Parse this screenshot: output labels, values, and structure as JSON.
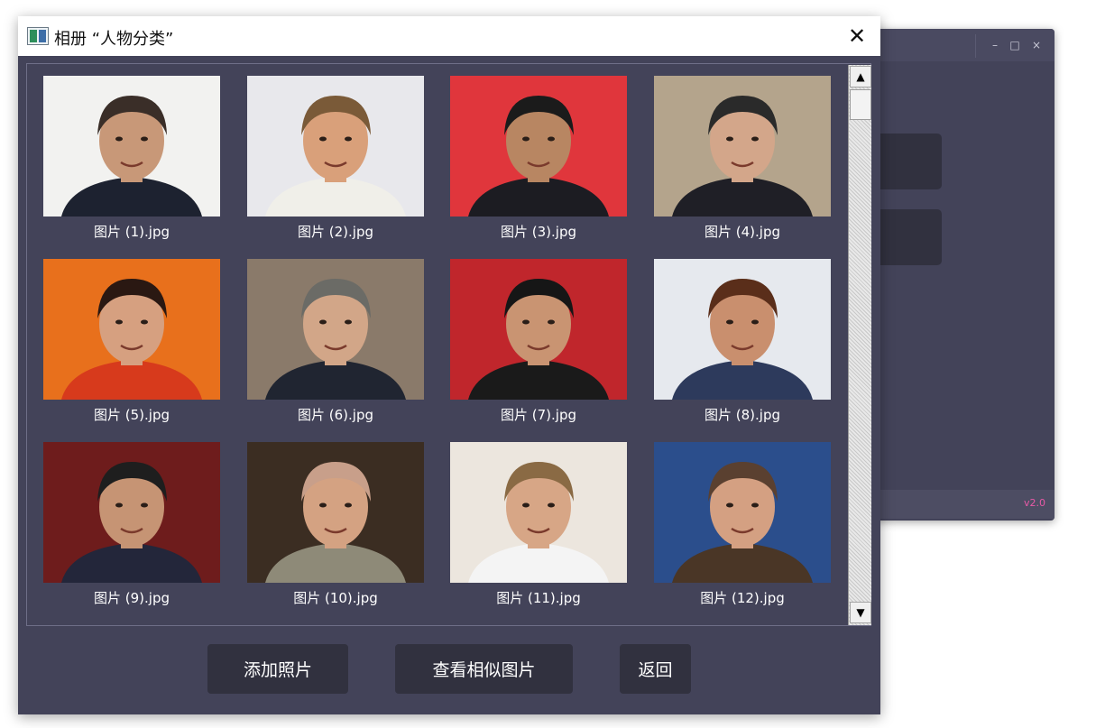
{
  "background_window": {
    "controls": {
      "minimize": "–",
      "maximize": "□",
      "close": "×"
    },
    "version": "v2.0"
  },
  "dialog": {
    "title": "相册 “人物分类”",
    "close_glyph": "✕"
  },
  "photos": [
    {
      "name": "图片 (1).jpg",
      "colors": {
        "bg": "#f2f2f0",
        "skin": "#c89878",
        "hair": "#3a2e28",
        "clothes": "#1d2230"
      }
    },
    {
      "name": "图片 (2).jpg",
      "colors": {
        "bg": "#e8e8ec",
        "skin": "#d9a07a",
        "hair": "#7a5a38",
        "clothes": "#f0efe9"
      }
    },
    {
      "name": "图片 (3).jpg",
      "colors": {
        "bg": "#e0363c",
        "skin": "#b88662",
        "hair": "#1b1b1b",
        "clothes": "#1c1c22"
      }
    },
    {
      "name": "图片 (4).jpg",
      "colors": {
        "bg": "#b4a48c",
        "skin": "#d3a68a",
        "hair": "#2a2a2a",
        "clothes": "#1f1f26"
      }
    },
    {
      "name": "图片 (5).jpg",
      "colors": {
        "bg": "#e8701c",
        "skin": "#d6a080",
        "hair": "#2a1812",
        "clothes": "#d73a1c"
      }
    },
    {
      "name": "图片 (6).jpg",
      "colors": {
        "bg": "#8a7a6a",
        "skin": "#d2a688",
        "hair": "#6b6b66",
        "clothes": "#202531"
      }
    },
    {
      "name": "图片 (7).jpg",
      "colors": {
        "bg": "#c0262c",
        "skin": "#c99472",
        "hair": "#161616",
        "clothes": "#1a1a1a"
      }
    },
    {
      "name": "图片 (8).jpg",
      "colors": {
        "bg": "#e6e9ee",
        "skin": "#c98f6e",
        "hair": "#5a2e1a",
        "clothes": "#2d3a5c"
      }
    },
    {
      "name": "图片 (9).jpg",
      "colors": {
        "bg": "#6e1c1c",
        "skin": "#c69474",
        "hair": "#1e1e1e",
        "clothes": "#23263a"
      }
    },
    {
      "name": "图片 (10).jpg",
      "colors": {
        "bg": "#3b2d22",
        "skin": "#d4a282",
        "hair": "#c89f8a",
        "clothes": "#8e8a78"
      }
    },
    {
      "name": "图片 (11).jpg",
      "colors": {
        "bg": "#ece6de",
        "skin": "#d7a686",
        "hair": "#8a6a44",
        "clothes": "#f4f4f4"
      }
    },
    {
      "name": "图片 (12).jpg",
      "colors": {
        "bg": "#2b4e8c",
        "skin": "#d4a082",
        "hair": "#5a4030",
        "clothes": "#4a3626"
      }
    }
  ],
  "scrollbar": {
    "up_glyph": "▲",
    "down_glyph": "▼"
  },
  "buttons": {
    "add_photo": "添加照片",
    "view_similar": "查看相似图片",
    "back": "返回"
  }
}
